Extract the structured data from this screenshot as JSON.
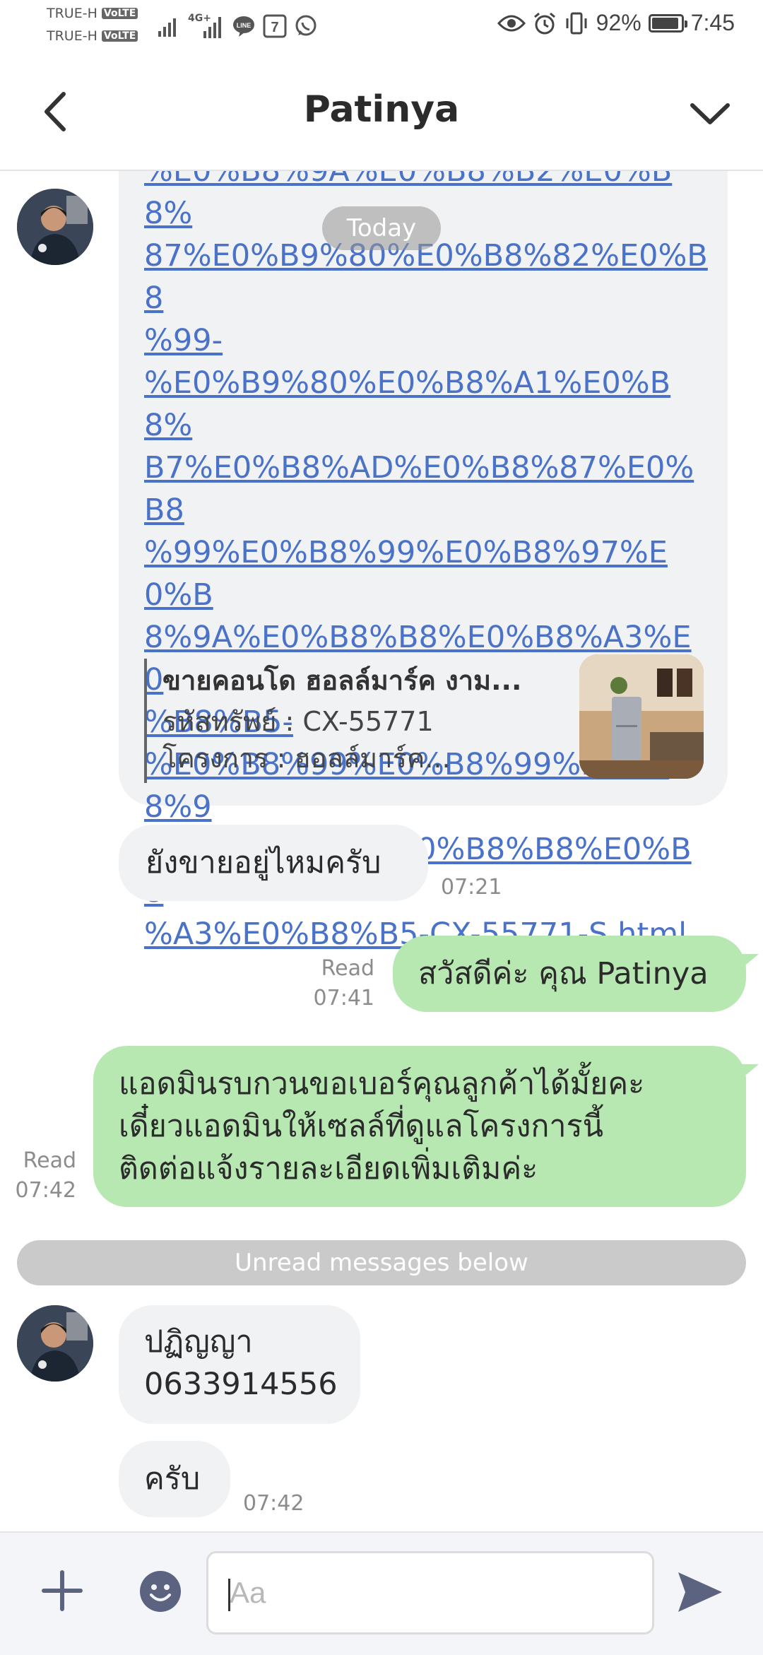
{
  "status_bar": {
    "carrier_1": "TRUE-H",
    "carrier_2": "TRUE-H",
    "volte": "VoLTE",
    "network": "4G+",
    "battery_percent": "92%",
    "battery_level": 0.92,
    "time": "7:45",
    "icons": [
      "signal-icon",
      "line-app-icon",
      "seven-eleven-icon",
      "whatsapp-icon",
      "eye-icon",
      "alarm-icon",
      "vibrate-icon",
      "battery-icon"
    ]
  },
  "header": {
    "title": "Patinya",
    "back_icon": "chevron-left-icon",
    "menu_icon": "chevron-down-icon"
  },
  "chat": {
    "date_pill": "Today",
    "link_message": {
      "url_lines": [
        "%E0%B8%9A%E0%B8%B2%E0%B8%",
        "87%E0%B9%80%E0%B8%82%E0%B8",
        "%99-",
        "%E0%B9%80%E0%B8%A1%E0%B8%",
        "B7%E0%B8%AD%E0%B8%87%E0%B8",
        "%99%E0%B8%99%E0%B8%97%E0%B",
        "8%9A%E0%B8%B8%E0%B8%A3%E0",
        "%B8%B5-",
        "%E0%B8%99%E0%B8%99%E0%B8%9",
        "7%E0%B8%9A%E0%B8%B8%E0%B8",
        "%A3%E0%B8%B5-CX-55771-S.html"
      ],
      "preview_title": "ขายคอนโด ฮอลล์มาร์ค งาม...",
      "preview_line1": "รหัสทรัพย์ : CX-55771",
      "preview_line2": "โครงการ : ฮอลล์มาร์ค..."
    },
    "msg_incoming_1": {
      "text": "ยังขายอยู่ไหมครับ",
      "time": "07:21"
    },
    "msg_outgoing_1": {
      "text": "สวัสดีค่ะ คุณ Patinya",
      "read": "Read",
      "time": "07:41"
    },
    "msg_outgoing_2": {
      "lines": [
        "แอดมินรบกวนขอเบอร์คุณลูกค้าได้มั้ยคะ",
        "เดี๋ยวแอดมินให้เซลล์ที่ดูแลโครงการนี้",
        "ติดต่อแจ้งรายละเอียดเพิ่มเติมค่ะ"
      ],
      "read": "Read",
      "time": "07:42"
    },
    "unread_divider": "Unread messages below",
    "msg_incoming_2": {
      "lines": [
        "ปฏิญญา",
        "0633914556"
      ]
    },
    "msg_incoming_3": {
      "text": "ครับ",
      "time": "07:42"
    }
  },
  "input_bar": {
    "placeholder": "Aa",
    "icons": [
      "plus-icon",
      "emoji-icon",
      "send-icon"
    ]
  },
  "colors": {
    "outgoing_bubble": "#b7e8b2",
    "incoming_bubble": "#f1f2f4",
    "link": "#4a72c8",
    "accent_icon": "#5b6381"
  }
}
